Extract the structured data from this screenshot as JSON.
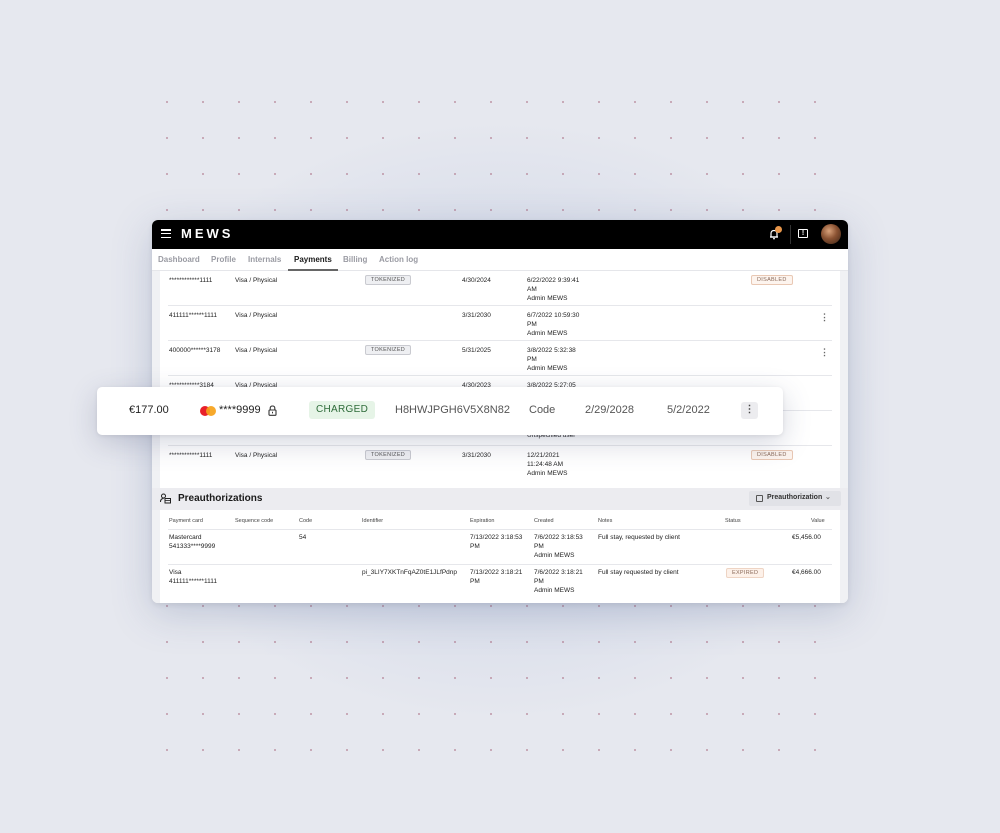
{
  "app": {
    "brand": "MEWS",
    "header_icons": [
      "menu-icon",
      "notification-bell-icon",
      "help-icon",
      "user-avatar"
    ]
  },
  "tabs": [
    {
      "label": "Dashboard",
      "active": false
    },
    {
      "label": "Profile",
      "active": false
    },
    {
      "label": "Internals",
      "active": false
    },
    {
      "label": "Payments",
      "active": true
    },
    {
      "label": "Billing",
      "active": false
    },
    {
      "label": "Action log",
      "active": false
    }
  ],
  "payment_cards": [
    {
      "number": "************1111",
      "type": "Visa / Physical",
      "tag": "TOKENIZED",
      "expiration": "4/30/2024",
      "created": [
        "6/22/2022 9:39:41",
        "AM",
        "Admin MEWS"
      ],
      "status": "DISABLED",
      "menu": false
    },
    {
      "number": "411111******1111",
      "type": "Visa / Physical",
      "tag": "",
      "expiration": "3/31/2030",
      "created": [
        "6/7/2022 10:59:30",
        "PM",
        "Admin MEWS"
      ],
      "status": "",
      "menu": true
    },
    {
      "number": "400000******3178",
      "type": "Visa / Physical",
      "tag": "TOKENIZED",
      "expiration": "5/31/2025",
      "created": [
        "3/8/2022 5:32:38",
        "PM",
        "Admin MEWS"
      ],
      "status": "",
      "menu": true
    },
    {
      "number": "************3184",
      "type": "Visa / Physical",
      "tag": "",
      "expiration": "4/30/2023",
      "created": [
        "3/8/2022 5:27:05",
        "",
        ""
      ],
      "status": "",
      "menu": false
    },
    {
      "number": "",
      "type": "",
      "tag": "",
      "expiration": "",
      "created": [
        "",
        "",
        "Unspecified user"
      ],
      "status": "",
      "menu": false
    },
    {
      "number": "************1111",
      "type": "Visa / Physical",
      "tag": "TOKENIZED",
      "expiration": "3/31/2030",
      "created": [
        "12/21/2021",
        "11:24:48 AM",
        "Admin MEWS"
      ],
      "status": "DISABLED",
      "menu": false
    }
  ],
  "charge_popup": {
    "amount": "€177.00",
    "card_brand": "mastercard-icon",
    "card_number": "****9999",
    "status": "CHARGED",
    "identifier": "H8HWJPGH6V5X8N82",
    "method": "Code",
    "expiration": "2/29/2028",
    "date": "5/2/2022"
  },
  "preauthorizations": {
    "title": "Preauthorizations",
    "add_button": "Preauthorization",
    "columns": [
      "Payment card",
      "Sequence code",
      "Code",
      "Identifier",
      "Expiration",
      "Created",
      "Notes",
      "Status",
      "Value"
    ],
    "rows": [
      {
        "card": "Mastercard",
        "card_number": "541333****9999",
        "sequence_code": "",
        "code": "54",
        "identifier": "",
        "expiration": [
          "7/13/2022 3:18:53",
          "PM"
        ],
        "created": [
          "7/6/2022 3:18:53",
          "PM",
          "Admin MEWS"
        ],
        "notes": "Full stay, requested by client",
        "status": "",
        "value": "€5,456.00"
      },
      {
        "card": "Visa",
        "card_number": "411111******1111",
        "sequence_code": "",
        "code": "",
        "identifier": "pi_3LIY7XKTnFqAZ0tE1JLfPdnp",
        "expiration": [
          "7/13/2022 3:18:21",
          "PM"
        ],
        "created": [
          "7/6/2022 3:18:21",
          "PM",
          "Admin MEWS"
        ],
        "notes": "Full stay requested by client",
        "status": "EXPIRED",
        "value": "€4,666.00"
      }
    ]
  }
}
